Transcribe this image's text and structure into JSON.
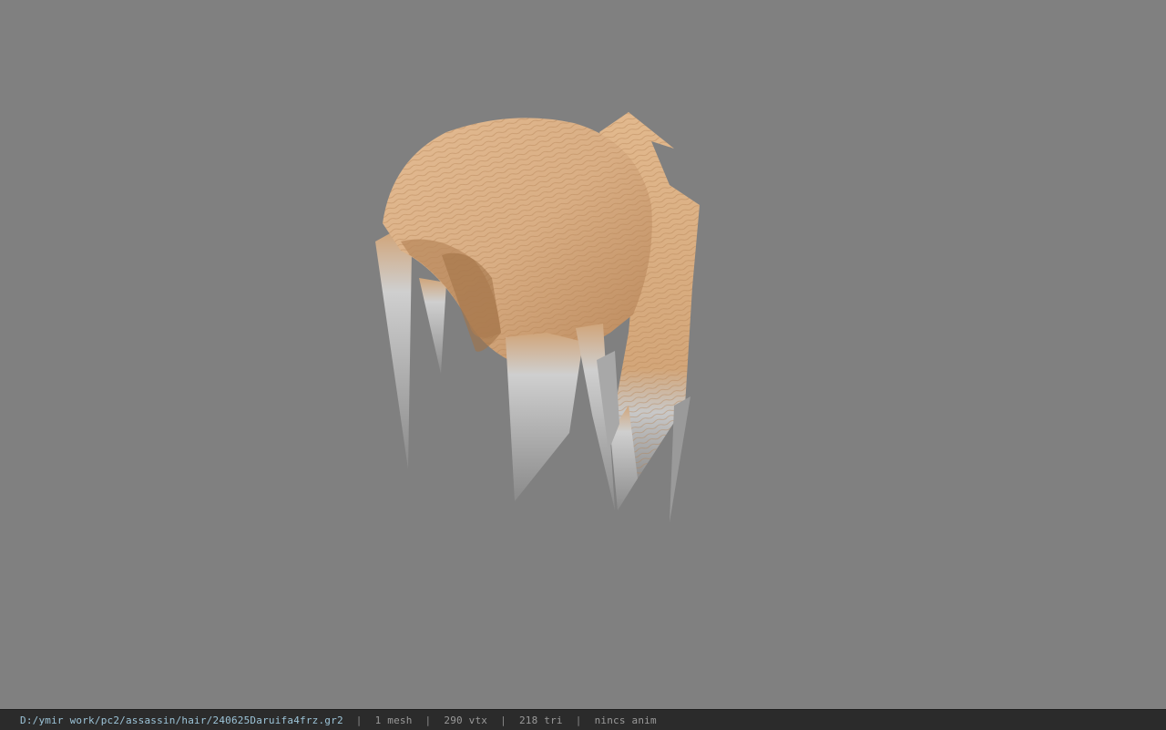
{
  "viewport": {
    "background": "#808080",
    "model": {
      "icon": "hair-mesh-model",
      "colors": {
        "hair_base": "#d9b088",
        "hair_light": "#ecc9a0",
        "hair_dark": "#a8794d",
        "tips": "#c9c9c9",
        "tips_dark": "#8e8e8e"
      }
    }
  },
  "statusbar": {
    "path": "D:/ymir work/pc2/assassin/hair/240625Daruifa4frz.gr2",
    "separator": "|",
    "mesh_count": "1 mesh",
    "vertex_count": "290 vtx",
    "triangle_count": "218 tri",
    "anim": "nincs anim"
  }
}
